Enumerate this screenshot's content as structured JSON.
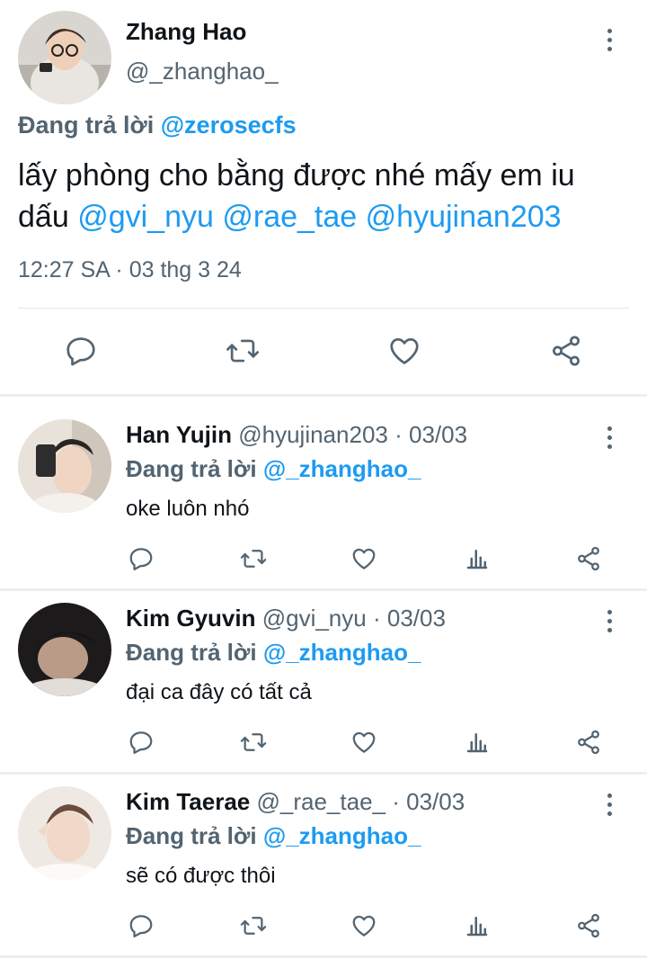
{
  "main_tweet": {
    "author_name": "Zhang Hao",
    "author_handle": "@_zhanghao_",
    "replying_prefix": "Đang trả lời",
    "replying_to": "@zerosecfs",
    "text_part1": "lấy phòng cho bằng được nhé mấy em iu dấu",
    "mentions": [
      "@gvi_nyu",
      "@rae_tae",
      "@hyujinan203"
    ],
    "timestamp": "12:27 SA · 03 thg 3 24",
    "actions": [
      "reply-icon",
      "retweet-icon",
      "like-icon",
      "share-icon"
    ]
  },
  "replies": [
    {
      "author_name": "Han Yujin",
      "author_handle": "@hyujinan203",
      "dot": "·",
      "date": "03/03",
      "replying_prefix": "Đang trả lời",
      "replying_to": "@_zhanghao_",
      "text": "oke luôn nhó"
    },
    {
      "author_name": "Kim Gyuvin",
      "author_handle": "@gvi_nyu",
      "dot": "·",
      "date": "03/03",
      "replying_prefix": "Đang trả lời",
      "replying_to": "@_zhanghao_",
      "text": "đại ca đây có tất cả"
    },
    {
      "author_name": "Kim Taerae",
      "author_handle": "@_rae_tae_",
      "dot": "·",
      "date": "03/03",
      "replying_prefix": "Đang trả lời",
      "replying_to": "@_zhanghao_",
      "text": "sẽ có được thôi"
    }
  ],
  "colors": {
    "accent": "#1d9bf0",
    "secondary_text": "#536471",
    "primary_text": "#0f1419",
    "divider": "#eceff1"
  }
}
